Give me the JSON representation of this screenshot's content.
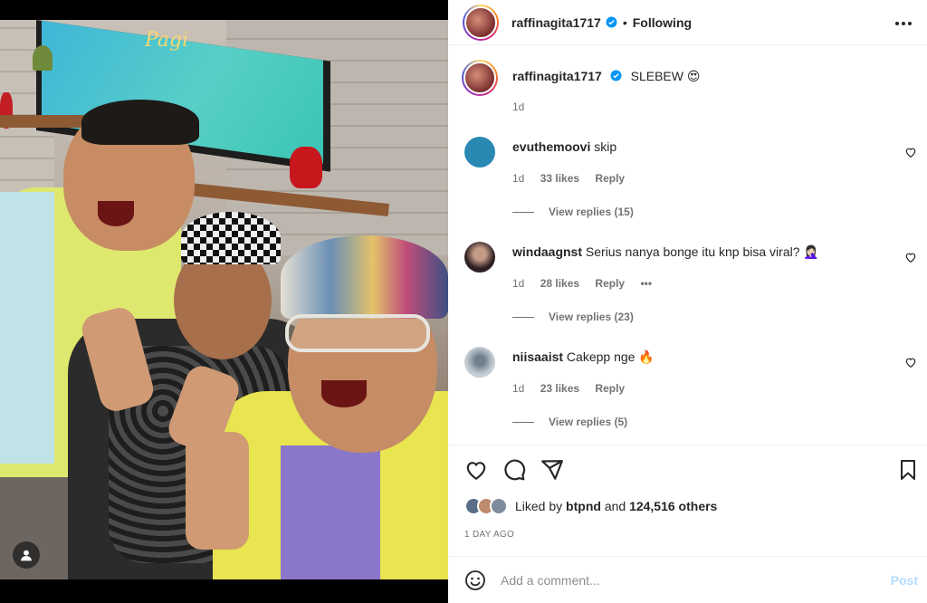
{
  "post": {
    "author": "raffinagita1717",
    "follow_label": "Following",
    "separator": "•"
  },
  "caption": {
    "username": "raffinagita1717",
    "text": "SLEBEW",
    "emoji": "😍",
    "time": "1d"
  },
  "media": {
    "tv_text": "Pagi"
  },
  "comments": [
    {
      "username": "evuthemoovi",
      "text": "skip",
      "emoji": "",
      "time": "1d",
      "likes": "33 likes",
      "reply": "Reply",
      "view_replies": "View replies (15)",
      "avatar_color": "#2a89b2"
    },
    {
      "username": "windaagnst",
      "text": "Serius nanya bonge itu knp bisa viral?",
      "emoji": "🤦🏻‍♀️",
      "time": "1d",
      "likes": "28 likes",
      "reply": "Reply",
      "more": "•••",
      "view_replies": "View replies (23)",
      "avatar_color": "#3b2a2c"
    },
    {
      "username": "niisaaist",
      "text": "Cakepp nge",
      "emoji": "🔥",
      "time": "1d",
      "likes": "23 likes",
      "reply": "Reply",
      "view_replies": "View replies (5)",
      "avatar_color": "#9aa6b1"
    }
  ],
  "likes": {
    "prefix": "Liked by",
    "user": "btpnd",
    "conj": "and",
    "others": "124,516 others"
  },
  "time_ago": "1 DAY AGO",
  "add_comment": {
    "placeholder": "Add a comment...",
    "post_label": "Post"
  },
  "colors": {
    "verified": "#0095f6",
    "post_disabled": "#b3dbff",
    "muted": "#737373"
  },
  "icons": [
    "more-icon",
    "heart-icon",
    "comment-icon",
    "share-icon",
    "bookmark-icon",
    "emoji-icon",
    "user-tag-icon",
    "verified-icon"
  ]
}
